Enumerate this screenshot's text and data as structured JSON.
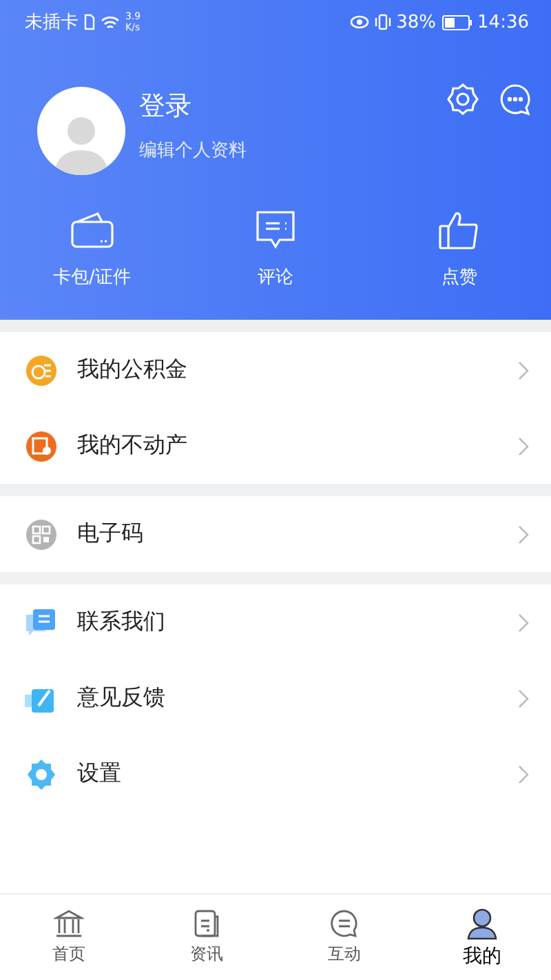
{
  "status_bar": {
    "carrier": "未插卡",
    "speed_value": "3.9",
    "speed_unit": "K/s",
    "battery": "38%",
    "time": "14:36"
  },
  "profile": {
    "name": "登录",
    "subtitle": "编辑个人资料"
  },
  "shortcuts": [
    {
      "label": "卡包/证件"
    },
    {
      "label": "评论"
    },
    {
      "label": "点赞"
    }
  ],
  "menu_groups": [
    [
      {
        "label": "我的公积金"
      },
      {
        "label": "我的不动产"
      }
    ],
    [
      {
        "label": "电子码"
      }
    ],
    [
      {
        "label": "联系我们"
      },
      {
        "label": "意见反馈"
      },
      {
        "label": "设置"
      }
    ]
  ],
  "tabs": [
    {
      "label": "首页",
      "selected": false
    },
    {
      "label": "资讯",
      "selected": false
    },
    {
      "label": "互动",
      "selected": false
    },
    {
      "label": "我的",
      "selected": true
    }
  ]
}
